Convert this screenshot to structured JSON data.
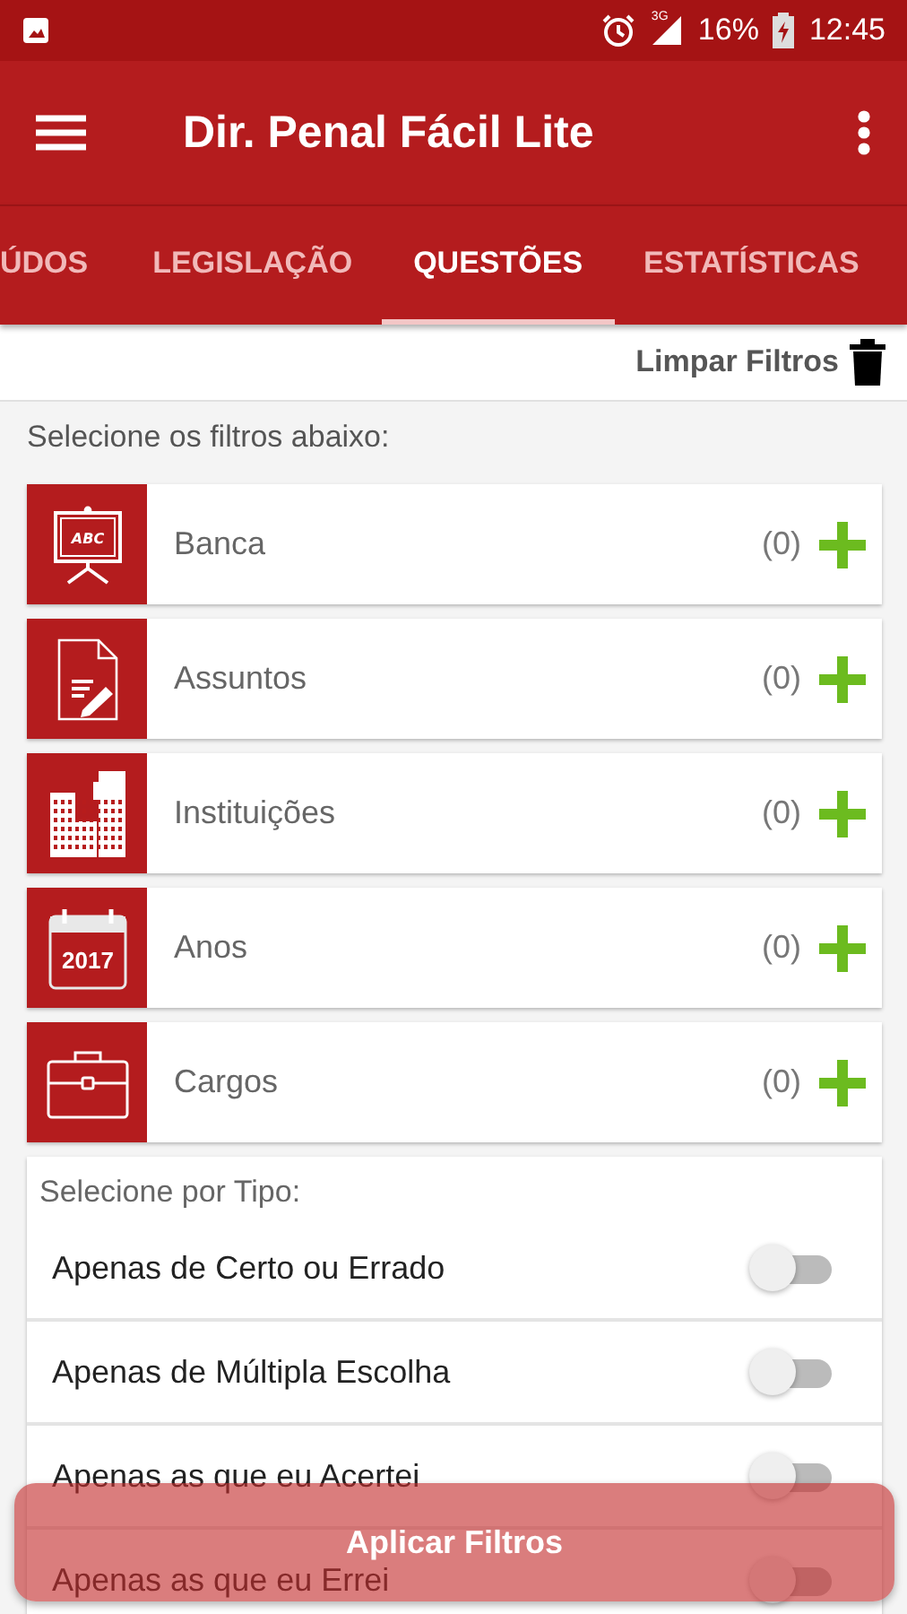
{
  "status_bar": {
    "network": "3G",
    "battery": "16%",
    "time": "12:45"
  },
  "app_bar": {
    "title": "Dir. Penal Fácil Lite"
  },
  "tabs": [
    {
      "label": "ÚDOS",
      "selected": false
    },
    {
      "label": "LEGISLAÇÃO",
      "selected": false
    },
    {
      "label": "QUESTÕES",
      "selected": true
    },
    {
      "label": "ESTATÍSTICAS",
      "selected": false
    }
  ],
  "clear_filters": "Limpar Filtros",
  "filters_heading": "Selecione os filtros abaixo:",
  "filters": [
    {
      "label": "Banca",
      "count": "(0)",
      "icon_label": "ABC"
    },
    {
      "label": "Assuntos",
      "count": "(0)"
    },
    {
      "label": "Instituições",
      "count": "(0)"
    },
    {
      "label": "Anos",
      "count": "(0)",
      "icon_label": "2017"
    },
    {
      "label": "Cargos",
      "count": "(0)"
    }
  ],
  "type_heading": "Selecione por Tipo:",
  "type_options": [
    {
      "label": "Apenas de Certo ou Errado",
      "on": false
    },
    {
      "label": "Apenas de Múltipla Escolha",
      "on": false
    },
    {
      "label": "Apenas as que eu Acertei",
      "on": false
    },
    {
      "label": "Apenas as que eu Errei",
      "on": false
    }
  ],
  "apply_button": "Aplicar Filtros"
}
